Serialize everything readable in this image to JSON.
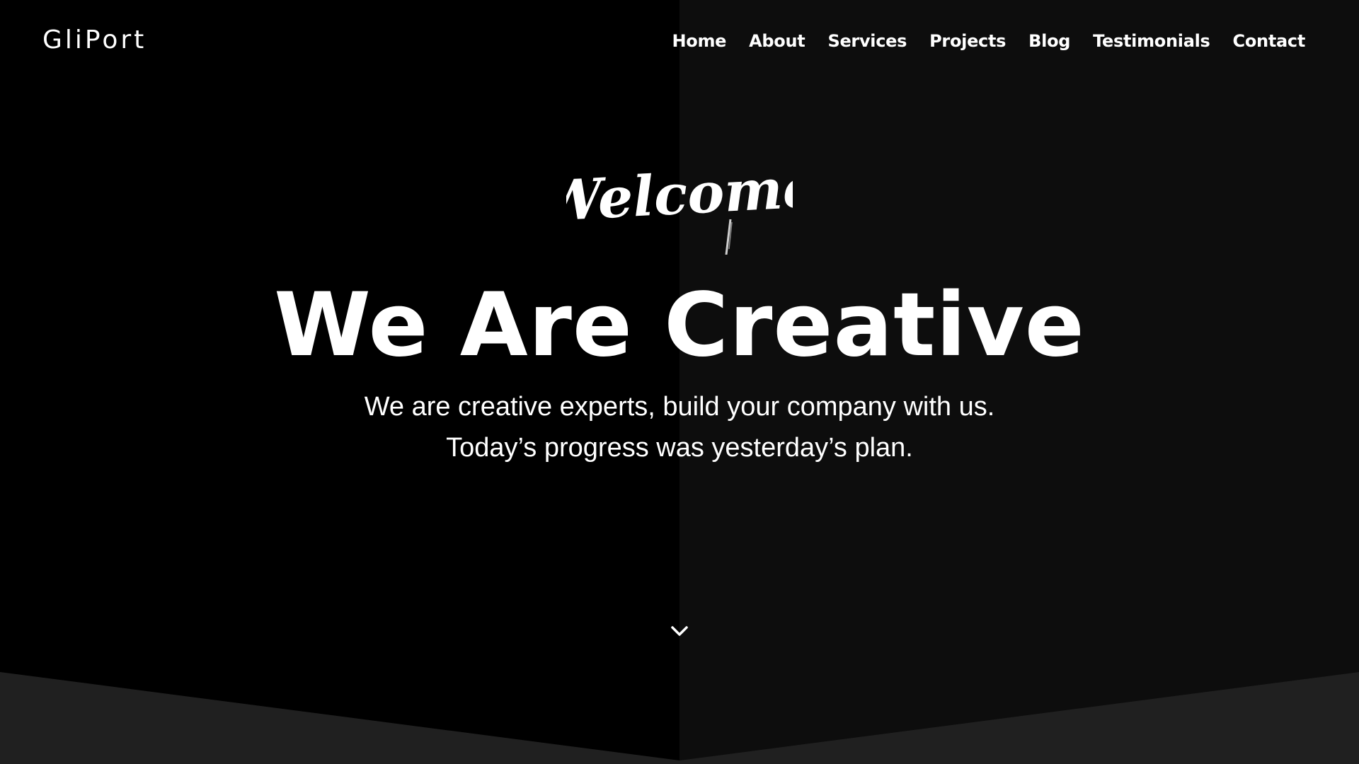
{
  "brand": {
    "name": "GliPort"
  },
  "nav": {
    "items": [
      {
        "label": "Home"
      },
      {
        "label": "About"
      },
      {
        "label": "Services"
      },
      {
        "label": "Projects"
      },
      {
        "label": "Blog"
      },
      {
        "label": "Testimonials"
      },
      {
        "label": "Contact"
      }
    ]
  },
  "hero": {
    "script_title": "Welcome",
    "headline": "We Are Creative",
    "subtitle_line1": "We are creative experts, build your company with us.",
    "subtitle_line2": "Today’s progress was yesterday’s plan.",
    "scroll_icon": "chevron-down-icon"
  },
  "colors": {
    "background_left": "#000000",
    "background_right": "#0d0d0d",
    "bottom_band": "#202020",
    "text": "#ffffff"
  }
}
